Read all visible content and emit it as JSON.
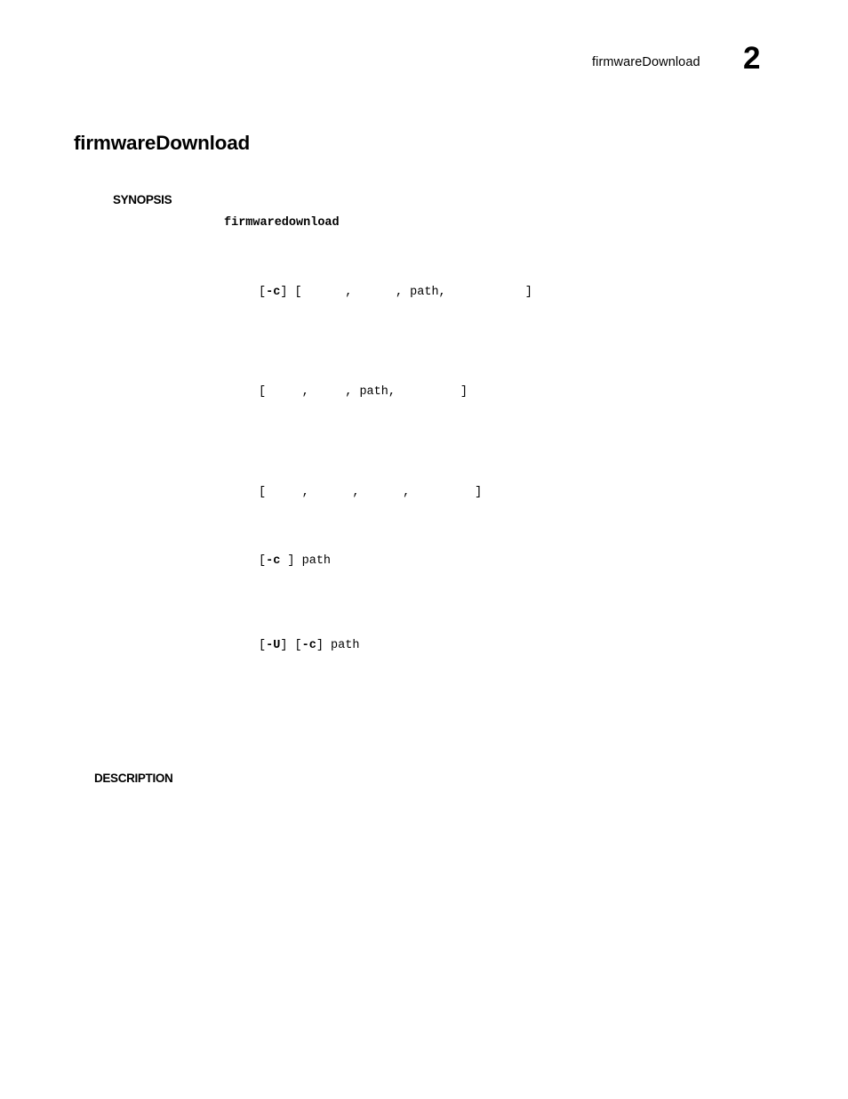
{
  "document": {
    "type": "command-reference-page",
    "background_color": "#ffffff",
    "text_color": "#000000"
  },
  "header": {
    "running_title": "firmwareDownload",
    "page_number": "2"
  },
  "command": {
    "title": "firmwareDownload"
  },
  "sections": {
    "synopsis": {
      "heading": "SYNOPSIS",
      "command_name": "firmwaredownload",
      "usage_lines": [
        {
          "id": "usage-line-1",
          "segments": [
            {
              "text": "[",
              "style": "plain"
            },
            {
              "text": "-c",
              "style": "bold"
            },
            {
              "text": "] [",
              "style": "plain"
            },
            {
              "text": "      ",
              "style": "gap"
            },
            {
              "text": ",",
              "style": "plain"
            },
            {
              "text": "      ",
              "style": "gap"
            },
            {
              "text": ", path,",
              "style": "plain"
            },
            {
              "text": "           ",
              "style": "gap"
            },
            {
              "text": "]",
              "style": "plain"
            }
          ],
          "plain_text": "[-c] [   ,    , path,        ]"
        },
        {
          "id": "usage-line-2",
          "segments": [
            {
              "text": "[",
              "style": "plain"
            },
            {
              "text": "     ",
              "style": "gap"
            },
            {
              "text": ",",
              "style": "plain"
            },
            {
              "text": "     ",
              "style": "gap"
            },
            {
              "text": ", path,",
              "style": "plain"
            },
            {
              "text": "         ",
              "style": "gap"
            },
            {
              "text": "]",
              "style": "plain"
            }
          ],
          "plain_text": "[    ,    , path,       ]"
        },
        {
          "id": "usage-line-3",
          "segments": [
            {
              "text": "[",
              "style": "plain"
            },
            {
              "text": "     ",
              "style": "gap"
            },
            {
              "text": ",",
              "style": "plain"
            },
            {
              "text": "      ",
              "style": "gap"
            },
            {
              "text": ",",
              "style": "plain"
            },
            {
              "text": "      ",
              "style": "gap"
            },
            {
              "text": ",",
              "style": "plain"
            },
            {
              "text": "         ",
              "style": "gap"
            },
            {
              "text": "]",
              "style": "plain"
            }
          ],
          "plain_text": "[    ,     ,     ,       ]"
        },
        {
          "id": "usage-line-4",
          "segments": [
            {
              "text": "[",
              "style": "plain"
            },
            {
              "text": "-c",
              "style": "bold"
            },
            {
              "text": " ] path",
              "style": "plain"
            }
          ],
          "plain_text": "[-c ] path"
        },
        {
          "id": "usage-line-5",
          "segments": [
            {
              "text": "[",
              "style": "plain"
            },
            {
              "text": "-U",
              "style": "bold"
            },
            {
              "text": "] [",
              "style": "plain"
            },
            {
              "text": "-c",
              "style": "bold"
            },
            {
              "text": "] path",
              "style": "plain"
            }
          ],
          "plain_text": "[-U] [-c] path"
        }
      ]
    },
    "description": {
      "heading": "DESCRIPTION",
      "body": ""
    }
  }
}
